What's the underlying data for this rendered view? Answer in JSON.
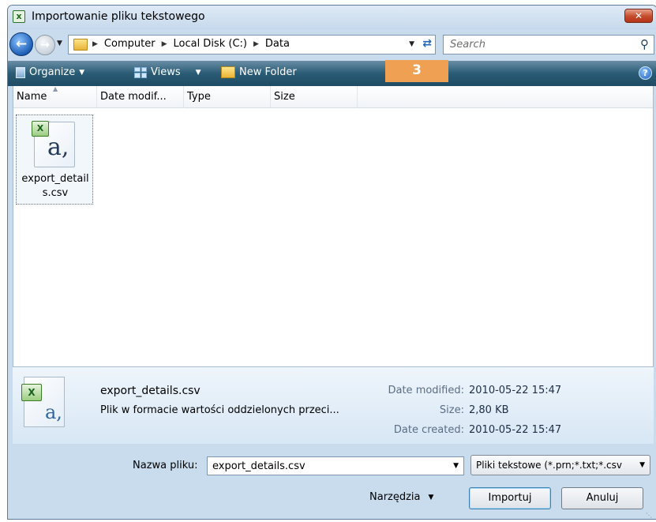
{
  "window": {
    "title": "Importowanie pliku tekstowego",
    "close_symbol": "✕"
  },
  "nav": {
    "breadcrumbs": [
      "Computer",
      "Local Disk (C:)",
      "Data"
    ],
    "search_placeholder": "Search"
  },
  "toolbar": {
    "organize": "Organize",
    "views": "Views",
    "new_folder": "New Folder"
  },
  "list": {
    "columns": [
      "Name",
      "Date modif...",
      "Type",
      "Size"
    ],
    "items": [
      {
        "name_line1": "export_detail",
        "name_line2": "s.csv"
      }
    ]
  },
  "details": {
    "name": "export_details.csv",
    "type": "Plik w formacie wartości oddzielonych przeci...",
    "date_modified_label": "Date modified:",
    "date_modified": "2010-05-22 15:47",
    "size_label": "Size:",
    "size": "2,80 KB",
    "date_created_label": "Date created:",
    "date_created": "2010-05-22 15:47"
  },
  "bottom": {
    "filename_label": "Nazwa pliku:",
    "filename_value": "export_details.csv",
    "filter_value": "Pliki tekstowe (*.prn;*.txt;*.csv",
    "tools_label": "Narzędzia",
    "import_button": "Importuj",
    "cancel_button": "Anuluj"
  },
  "step_badge": "3",
  "colors": {
    "toolbar": "#2a5b75",
    "window_frame": "#c8dcee",
    "badge": "#f0a052"
  }
}
